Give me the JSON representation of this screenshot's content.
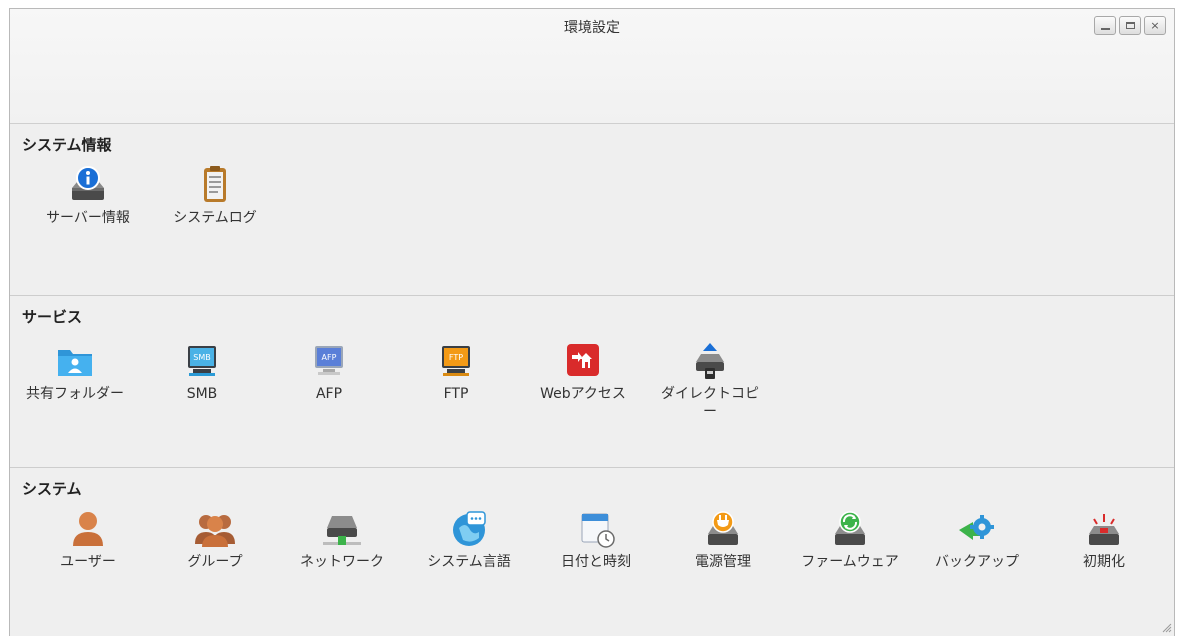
{
  "window": {
    "title": "環境設定",
    "buttons": {
      "minimize": "minimize",
      "maximize": "maximize",
      "close": "×"
    }
  },
  "sections": {
    "system_info": {
      "title": "システム情報",
      "items": [
        {
          "label": "サーバー情報",
          "icon": "server-info-icon"
        },
        {
          "label": "システムログ",
          "icon": "system-log-icon"
        }
      ]
    },
    "services": {
      "title": "サービス",
      "items": [
        {
          "label": "共有フォルダー",
          "icon": "shared-folder-icon"
        },
        {
          "label": "SMB",
          "icon": "smb-icon",
          "badge": "SMB"
        },
        {
          "label": "AFP",
          "icon": "afp-icon",
          "badge": "AFP"
        },
        {
          "label": "FTP",
          "icon": "ftp-icon",
          "badge": "FTP"
        },
        {
          "label": "Webアクセス",
          "icon": "web-access-icon"
        },
        {
          "label": "ダイレクトコピー",
          "icon": "direct-copy-icon"
        }
      ]
    },
    "system": {
      "title": "システム",
      "items": [
        {
          "label": "ユーザー",
          "icon": "user-icon"
        },
        {
          "label": "グループ",
          "icon": "group-icon"
        },
        {
          "label": "ネットワーク",
          "icon": "network-icon"
        },
        {
          "label": "システム言語",
          "icon": "language-icon"
        },
        {
          "label": "日付と時刻",
          "icon": "date-time-icon"
        },
        {
          "label": "電源管理",
          "icon": "power-icon"
        },
        {
          "label": "ファームウェア",
          "icon": "firmware-icon"
        },
        {
          "label": "バックアップ",
          "icon": "backup-icon"
        },
        {
          "label": "初期化",
          "icon": "reset-icon"
        }
      ]
    }
  },
  "colors": {
    "accent_blue": "#1a6fd6",
    "folder_blue": "#3da9e8",
    "ftp_orange": "#f39a16",
    "web_red": "#d92b2b",
    "user_orange": "#d9834a",
    "firmware_green": "#3cb34a"
  }
}
